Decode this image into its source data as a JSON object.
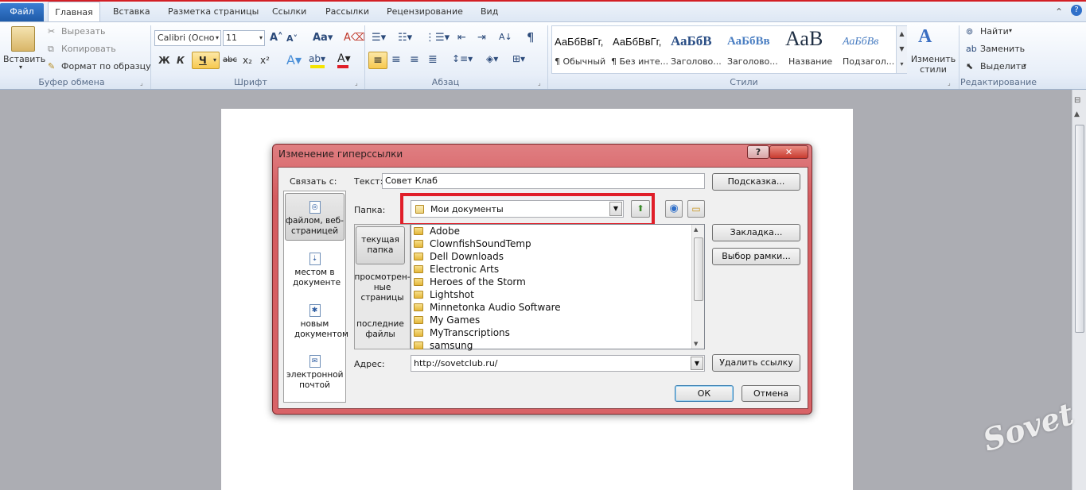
{
  "ribbon_tabs": [
    "Файл",
    "Главная",
    "Вставка",
    "Разметка страницы",
    "Ссылки",
    "Рассылки",
    "Рецензирование",
    "Вид"
  ],
  "clipboard": {
    "paste": "Вставить",
    "cut": "Вырезать",
    "copy": "Копировать",
    "format_painter": "Формат по образцу",
    "group": "Буфер обмена"
  },
  "font": {
    "name": "Calibri (Осно",
    "size": "11",
    "bold": "Ж",
    "italic": "К",
    "underline": "Ч",
    "strike": "abc",
    "sub": "x₂",
    "sup": "x²",
    "group": "Шрифт"
  },
  "paragraph": {
    "group": "Абзац",
    "pilcrow": "¶"
  },
  "styles": {
    "items": [
      {
        "sample": "АаБбВвГг,",
        "name": "¶ Обычный"
      },
      {
        "sample": "АаБбВвГг,",
        "name": "¶ Без инте..."
      },
      {
        "sample": "АаБбВ",
        "name": "Заголово..."
      },
      {
        "sample": "АаБбВв",
        "name": "Заголово..."
      },
      {
        "sample": "АаВ",
        "name": "Название"
      },
      {
        "sample": "АаБбВв",
        "name": "Подзагол..."
      }
    ],
    "change_styles": "Изменить стили",
    "group": "Стили"
  },
  "editing": {
    "find": "Найти",
    "replace": "Заменить",
    "select": "Выделить",
    "group": "Редактирование"
  },
  "dialog": {
    "title": "Изменение гиперссылки",
    "help": "?",
    "close": "✕",
    "link_to": "Связать с:",
    "text_label": "Текст:",
    "text_value": "Совет Клаб",
    "tooltip_btn": "Подсказка...",
    "folder_label": "Папка:",
    "folder_value": "Мои документы",
    "sidebar": [
      {
        "label": "файлом, веб-страницей"
      },
      {
        "label": "местом в документе"
      },
      {
        "label": "новым документом"
      },
      {
        "label": "электронной почтой"
      }
    ],
    "browse": [
      {
        "label": "текущая папка"
      },
      {
        "label": "просмотрен-ные страницы"
      },
      {
        "label": "последние файлы"
      }
    ],
    "files": [
      "Adobe",
      "ClownfishSoundTemp",
      "Dell Downloads",
      "Electronic Arts",
      "Heroes of the Storm",
      "Lightshot",
      "Minnetonka Audio Software",
      "My Games",
      "MyTranscriptions",
      "samsung"
    ],
    "bookmark_btn": "Закладка...",
    "frame_btn": "Выбор рамки...",
    "address_label": "Адрес:",
    "address_value": "http://sovetclub.ru/",
    "remove_btn": "Удалить ссылку",
    "ok": "ОК",
    "cancel": "Отмена"
  },
  "watermark": "Sovet club"
}
